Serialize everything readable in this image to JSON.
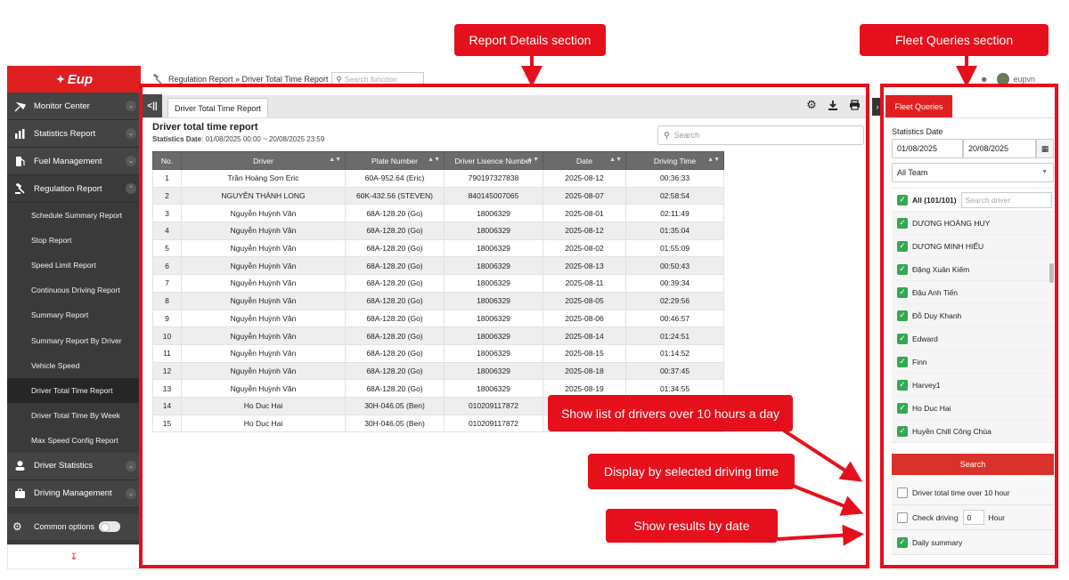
{
  "annotations": {
    "report_section": "Report Details section",
    "fleet_section": "Fleet Queries section",
    "note_over_10": "Show list of drivers over 10 hours a day",
    "note_driving_time": "Display by selected driving time",
    "note_by_date": "Show results by date"
  },
  "brand": {
    "logo_text": "Eup"
  },
  "sidebar": {
    "menus_top": [
      {
        "label": "Monitor Center",
        "icon": "satellite-icon"
      },
      {
        "label": "Statistics Report",
        "icon": "bar-chart-icon"
      },
      {
        "label": "Fuel Management",
        "icon": "fuel-pump-icon"
      },
      {
        "label": "Regulation Report",
        "icon": "gavel-icon"
      }
    ],
    "sub_items": [
      "Schedule Summary Report",
      "Stop Report",
      "Speed Limit Report",
      "Continuous Driving Report",
      "Summary Report",
      "Summary Report By Driver",
      "Vehicle Speed",
      "Driver Total Time Report",
      "Driver Total Time By Week",
      "Max Speed Config Report"
    ],
    "menus_bottom": [
      {
        "label": "Driver Statistics",
        "icon": "driver-icon"
      },
      {
        "label": "Driving Management",
        "icon": "briefcase-icon"
      }
    ],
    "common_options": "Common options"
  },
  "topbar": {
    "breadcrumb": "Regulation Report » Driver Total Time Report",
    "search_placeholder": "Search function",
    "username": "eupvn"
  },
  "report": {
    "tab_label": "Driver Total Time Report",
    "title": "Driver total time report",
    "date_label": "Statistics Date",
    "date_value": ": 01/08/2025 00:00 ~ 20/08/2025 23:59",
    "search_placeholder": "Search",
    "columns": [
      "No.",
      "Driver",
      "Plate Number",
      "Driver Lisence Number",
      "Date",
      "Driving Time"
    ],
    "rows": [
      [
        "1",
        "Trần Hoàng Sơn Eric",
        "60A-952.64 (Eric)",
        "790197327838",
        "2025-08-12",
        "00:36:33"
      ],
      [
        "2",
        "NGUYỄN THÀNH LONG",
        "60K-432.56 (STEVEN)",
        "840145007065",
        "2025-08-07",
        "02:58:54"
      ],
      [
        "3",
        "Nguyễn Huỳnh Văn",
        "68A-128.20 (Go)",
        "18006329",
        "2025-08-01",
        "02:11:49"
      ],
      [
        "4",
        "Nguyễn Huỳnh Văn",
        "68A-128.20 (Go)",
        "18006329",
        "2025-08-12",
        "01:35:04"
      ],
      [
        "5",
        "Nguyễn Huỳnh Văn",
        "68A-128.20 (Go)",
        "18006329",
        "2025-08-02",
        "01:55:09"
      ],
      [
        "6",
        "Nguyễn Huỳnh Văn",
        "68A-128.20 (Go)",
        "18006329",
        "2025-08-13",
        "00:50:43"
      ],
      [
        "7",
        "Nguyễn Huỳnh Văn",
        "68A-128.20 (Go)",
        "18006329",
        "2025-08-11",
        "00:39:34"
      ],
      [
        "8",
        "Nguyễn Huỳnh Văn",
        "68A-128.20 (Go)",
        "18006329",
        "2025-08-05",
        "02:29:56"
      ],
      [
        "9",
        "Nguyễn Huỳnh Văn",
        "68A-128.20 (Go)",
        "18006329",
        "2025-08-06",
        "00:46:57"
      ],
      [
        "10",
        "Nguyễn Huỳnh Văn",
        "68A-128.20 (Go)",
        "18006329",
        "2025-08-14",
        "01:24:51"
      ],
      [
        "11",
        "Nguyễn Huỳnh Văn",
        "68A-128.20 (Go)",
        "18006329",
        "2025-08-15",
        "01:14:52"
      ],
      [
        "12",
        "Nguyễn Huỳnh Văn",
        "68A-128.20 (Go)",
        "18006329",
        "2025-08-18",
        "00:37:45"
      ],
      [
        "13",
        "Nguyễn Huỳnh Văn",
        "68A-128.20 (Go)",
        "18006329",
        "2025-08-19",
        "01:34:55"
      ],
      [
        "14",
        "Ho Duc Hai",
        "30H-046.05 (Ben)",
        "010209117872",
        "",
        ""
      ],
      [
        "15",
        "Ho Duc Hai",
        "30H-046.05 (Ben)",
        "010209117872",
        "",
        ""
      ]
    ]
  },
  "fleet": {
    "tab_label": "Fleet Queries",
    "date_label": "Statistics Date",
    "date_from": "01/08/2025",
    "date_to": "20/08/2025",
    "team": "All Team",
    "all_label": "All (101/101)",
    "search_driver_placeholder": "Search driver",
    "drivers": [
      "DƯƠNG HOÀNG HUY",
      "DƯƠNG MINH HIẾU",
      "Đặng Xuân Kiếm",
      "Đậu Anh Tiến",
      "Đỗ Duy Khanh",
      "Edward",
      "Finn",
      "Harvey1",
      "Ho Duc Hai",
      "Huyền Chill Công Chúa"
    ],
    "search_button": "Search",
    "opt_over_10": "Driver total time over 10 hour",
    "opt_check_driving": "Check driving",
    "check_driving_value": "0",
    "hour_label": "Hour",
    "opt_daily": "Daily summary"
  },
  "colors": {
    "accent": "#e02020",
    "annotation": "#e5101b",
    "check": "#34a853"
  }
}
